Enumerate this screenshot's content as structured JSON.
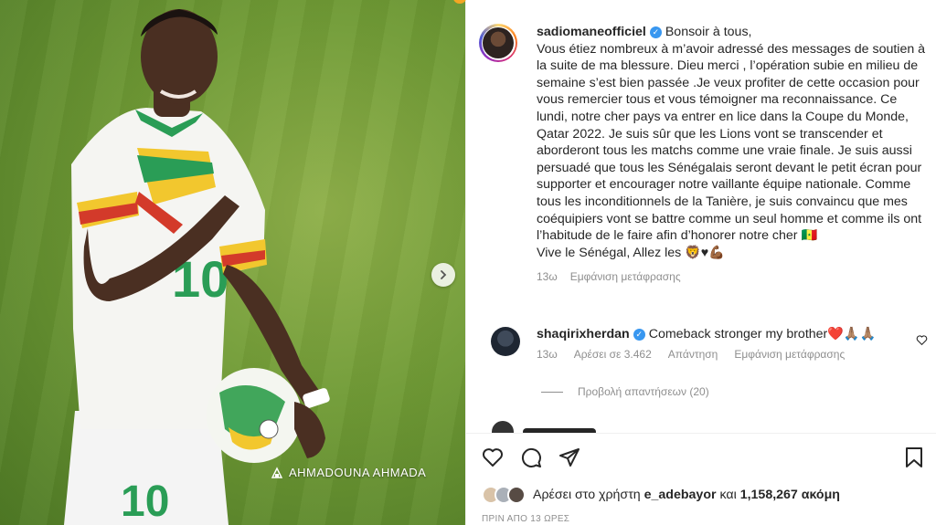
{
  "post": {
    "photo_watermark": "AHMADOUNA AHMADA",
    "author": {
      "username": "sadiomaneofficiel",
      "verified": true
    },
    "caption_lines": [
      "Bonsoir à tous,",
      "Vous étiez nombreux à m’avoir adressé des messages de soutien à la suite de ma blessure. Dieu merci , l’opération subie en milieu de semaine s’est bien passée .Je veux profiter de cette occasion pour vous remercier tous et vous témoigner ma reconnaissance. Ce lundi, notre cher pays va entrer en lice dans la Coupe du Monde, Qatar 2022. Je suis sûr que les Lions vont se transcender et aborderont tous les matchs comme une vraie finale. Je suis aussi persuadé que tous les Sénégalais seront devant le petit écran pour supporter et encourager notre vaillante équipe nationale. Comme tous les inconditionnels de la Tanière, je suis convaincu que mes coéquipiers vont se battre comme un seul homme et comme ils ont l’habitude de le faire afin d’honorer notre cher 🇸🇳",
      "Vive le Sénégal, Allez les 🦁♥💪🏾"
    ],
    "caption_age": "13ω",
    "see_translation": "Εμφάνιση μετάφρασης"
  },
  "comment": {
    "username": "shaqirixherdan",
    "verified": true,
    "text": "Comeback stronger my brother❤️🙏🏽🙏🏽",
    "age": "13ω",
    "likes": "Αρέσει σε 3.462",
    "reply": "Απάντηση",
    "see_translation": "Εμφάνιση μετάφρασης",
    "view_replies": "Προβολή απαντήσεων (20)"
  },
  "footer": {
    "liked_by_prefix": "Αρέσει στο χρήστη",
    "liked_by_user": "e_adebayor",
    "liked_by_and": "και",
    "liked_by_count": "1,158,267 ακόμη",
    "timestamp": "ΠΡΙΝ ΑΠΟ 13 ΩΡΕΣ"
  },
  "colors": {
    "accent": "#3897f0",
    "heart": "#ed4956",
    "muted": "#8e8e8e",
    "text": "#262626"
  },
  "icons": [
    "chevron-right-icon",
    "heart-icon",
    "comment-icon",
    "share-icon",
    "bookmark-icon",
    "verified-icon",
    "camera-logo-icon"
  ]
}
